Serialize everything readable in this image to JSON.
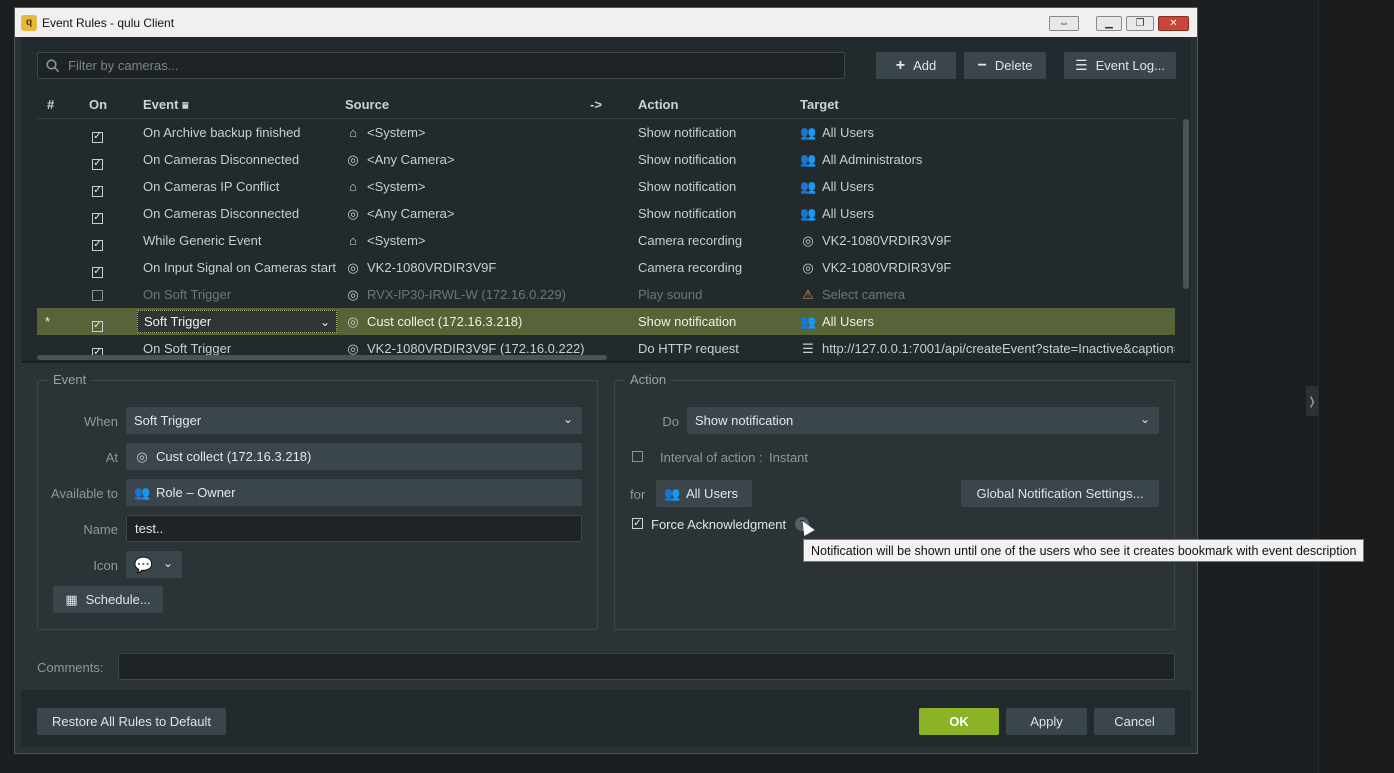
{
  "window": {
    "title": "Event Rules - qulu Client",
    "app_icon": "app-logo-icon"
  },
  "toolbar": {
    "filter_placeholder": "Filter by cameras...",
    "add_label": "Add",
    "delete_label": "Delete",
    "event_log_label": "Event Log..."
  },
  "table": {
    "headers": {
      "index": "#",
      "on": "On",
      "event": "Event",
      "source": "Source",
      "arrow": "->",
      "action": "Action",
      "target": "Target"
    },
    "rows": [
      {
        "marker": "",
        "on": true,
        "event": "On Archive backup finished",
        "source_icon": "home-icon",
        "source": "<System>",
        "action": "Show notification",
        "target_icon": "users-icon",
        "target": "All Users",
        "state": "normal"
      },
      {
        "marker": "",
        "on": true,
        "event": "On Cameras Disconnected",
        "source_icon": "camera-icon",
        "source": "<Any Camera>",
        "action": "Show notification",
        "target_icon": "users-icon",
        "target": "All Administrators",
        "state": "normal"
      },
      {
        "marker": "",
        "on": true,
        "event": "On Cameras IP Conflict",
        "source_icon": "home-icon",
        "source": "<System>",
        "action": "Show notification",
        "target_icon": "users-icon",
        "target": "All Users",
        "state": "normal"
      },
      {
        "marker": "",
        "on": true,
        "event": "On Cameras Disconnected",
        "source_icon": "camera-icon",
        "source": "<Any Camera>",
        "action": "Show notification",
        "target_icon": "users-icon",
        "target": "All Users",
        "state": "normal"
      },
      {
        "marker": "",
        "on": true,
        "event": "While Generic Event",
        "source_icon": "home-icon",
        "source": "<System>",
        "action": "Camera recording",
        "target_icon": "camera-icon",
        "target": "VK2-1080VRDIR3V9F",
        "state": "normal"
      },
      {
        "marker": "",
        "on": true,
        "event": "On Input Signal on Cameras start",
        "source_icon": "camera-icon",
        "source": "VK2-1080VRDIR3V9F",
        "action": "Camera recording",
        "target_icon": "camera-icon",
        "target": "VK2-1080VRDIR3V9F",
        "state": "normal"
      },
      {
        "marker": "",
        "on": false,
        "event": "On Soft Trigger",
        "source_icon": "camera-icon",
        "source": "RVX-IP30-IRWL-W (172.16.0.229)",
        "action": "Play sound",
        "target_icon": "warning-icon",
        "target": "Select camera",
        "state": "disabled"
      },
      {
        "marker": "*",
        "on": true,
        "event": "Soft Trigger",
        "source_icon": "camera-icon",
        "source": "Cust collect (172.16.3.218)",
        "action": "Show notification",
        "target_icon": "users-icon",
        "target": "All Users",
        "state": "selected"
      },
      {
        "marker": "",
        "on": true,
        "event": "On Soft Trigger",
        "source_icon": "camera-icon",
        "source": "VK2-1080VRDIR3V9F (172.16.0.222)",
        "action": "Do HTTP request",
        "target_icon": "list-icon",
        "target": "http://127.0.0.1:7001/api/createEvent?state=Inactive&caption=",
        "state": "normal"
      }
    ]
  },
  "event_group": {
    "title": "Event",
    "when_label": "When",
    "when_value": "Soft Trigger",
    "at_label": "At",
    "at_value": "Cust collect (172.16.3.218)",
    "available_label": "Available to",
    "available_value": "Role – Owner",
    "name_label": "Name",
    "name_value": "test..",
    "icon_label": "Icon",
    "schedule_label": "Schedule..."
  },
  "action_group": {
    "title": "Action",
    "do_label": "Do",
    "do_value": "Show notification",
    "interval_label": "Interval of action :",
    "interval_value": "Instant",
    "for_label": "for",
    "for_value": "All Users",
    "global_settings_label": "Global Notification Settings...",
    "force_ack_label": "Force Acknowledgment",
    "force_ack_checked": true
  },
  "tooltip": {
    "text": "Notification will be shown until one of the users who see it creates bookmark with event description"
  },
  "comments": {
    "label": "Comments:",
    "value": ""
  },
  "footer": {
    "restore_label": "Restore All Rules to Default",
    "ok_label": "OK",
    "apply_label": "Apply",
    "cancel_label": "Cancel"
  },
  "colors": {
    "accent": "#8cb325",
    "selected_row": "#566438",
    "background": "#2b3337"
  }
}
